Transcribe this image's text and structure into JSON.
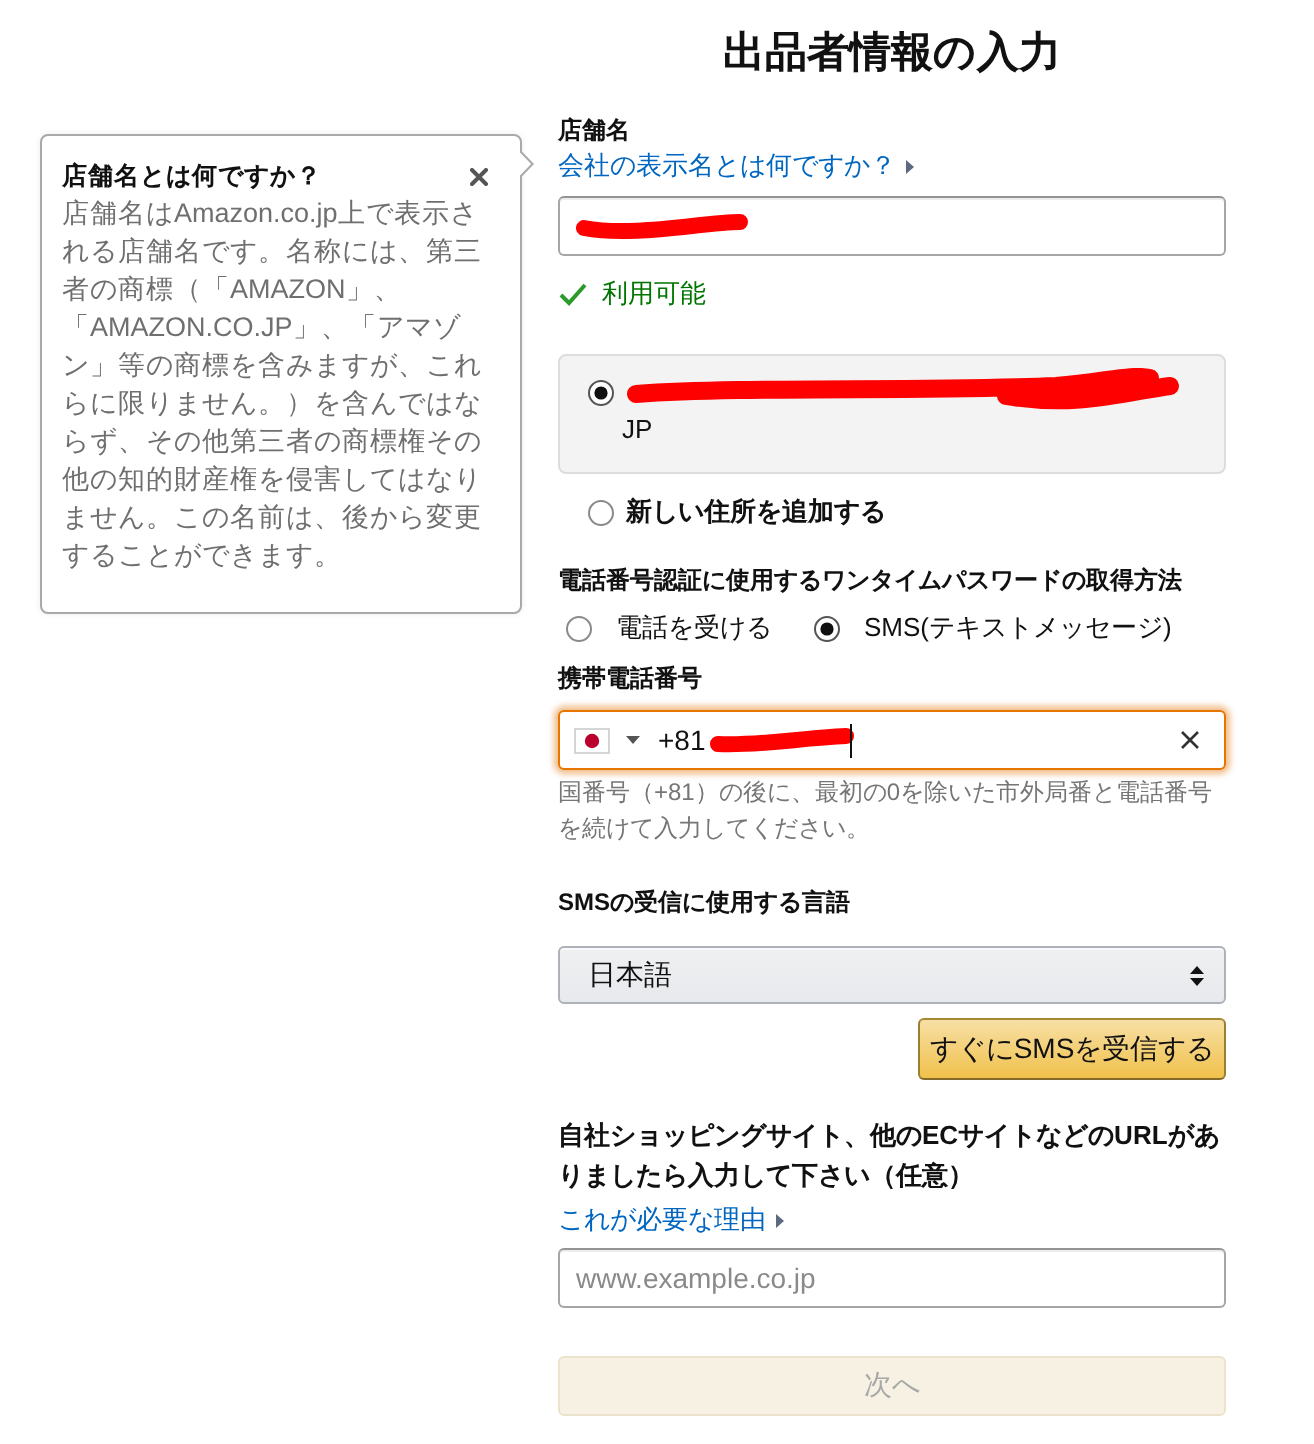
{
  "page_title": "出品者情報の入力",
  "help_popover": {
    "title": "店舗名とは何ですか？",
    "body": "店舗名はAmazon.co.jp上で表示される店舗名です。名称には、第三者の商標（「AMAZON」、「AMAZON.CO.JP」、「アマゾン」等の商標を含みますが、これらに限りません。）を含んではならず、その他第三者の商標権その他の知的財産権を侵害してはなりません。この名前は、後から変更することができます。"
  },
  "store_name": {
    "label": "店舗名",
    "help_link": "会社の表示名とは何ですか？",
    "redacted": true,
    "availability": "利用可能"
  },
  "address_options": [
    {
      "kind": "saved",
      "text": "JP",
      "redacted": true,
      "selected": true
    },
    {
      "kind": "new",
      "text": "新しい住所を追加する",
      "selected": false
    }
  ],
  "otp_method": {
    "label": "電話番号認証に使用するワンタイムパスワードの取得方法",
    "options": [
      {
        "label": "電話を受ける",
        "selected": false
      },
      {
        "label": "SMS(テキストメッセージ)",
        "selected": true
      }
    ]
  },
  "mobile_phone": {
    "label": "携帯電話番号",
    "value": "+81",
    "redacted": true,
    "focused": true,
    "hint": "国番号（+81）の後に、最初の0を除いた市外局番と電話番号を続けて入力してください。"
  },
  "sms_language": {
    "label": "SMSの受信に使用する言語",
    "value": "日本語"
  },
  "send_sms_button": {
    "label": "すぐにSMSを受信する"
  },
  "website": {
    "label": "自社ショッピングサイト、他のECサイトなどのURLがありましたら入力して下さい（任意）",
    "help_link": "これが必要な理由",
    "placeholder": "www.example.co.jp"
  },
  "next_button": {
    "label": "次へ",
    "disabled": true
  }
}
